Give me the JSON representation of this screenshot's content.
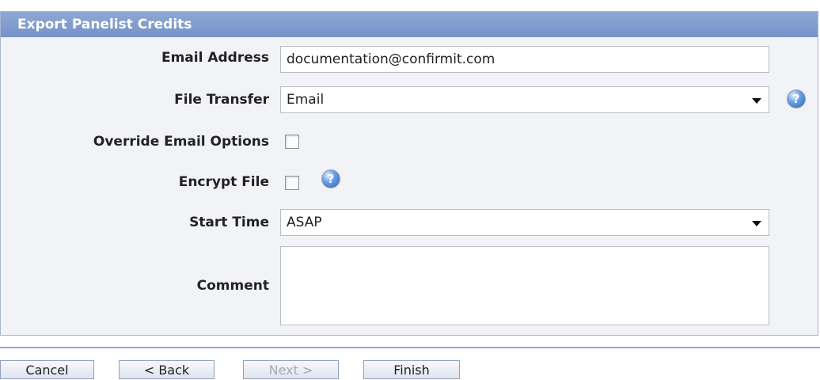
{
  "panel": {
    "title": "Export Panelist Credits"
  },
  "form": {
    "email": {
      "label": "Email Address",
      "value": "documentation@confirmit.com"
    },
    "file_transfer": {
      "label": "File Transfer",
      "value": "Email"
    },
    "override_email": {
      "label": "Override Email Options",
      "checked": false
    },
    "encrypt_file": {
      "label": "Encrypt File",
      "checked": false
    },
    "start_time": {
      "label": "Start Time",
      "value": "ASAP"
    },
    "comment": {
      "label": "Comment",
      "value": ""
    }
  },
  "icons": {
    "help": "?"
  },
  "buttons": {
    "cancel": "Cancel",
    "back": "< Back",
    "next": "Next >",
    "finish": "Finish"
  }
}
